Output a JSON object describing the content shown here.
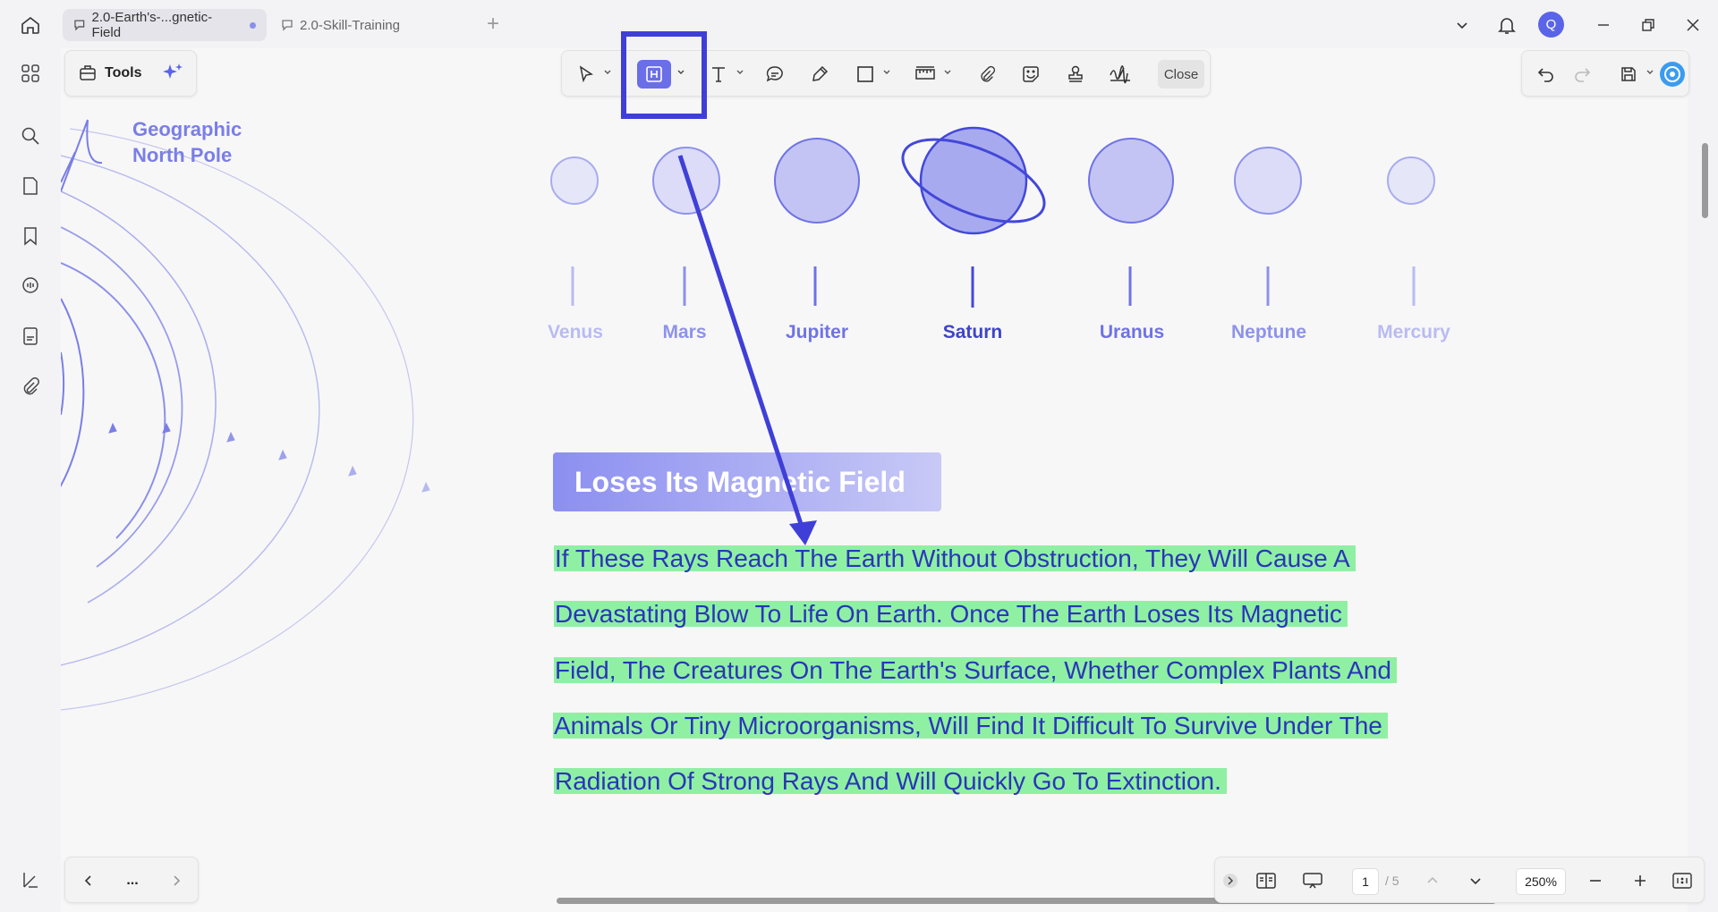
{
  "tabs": [
    {
      "label": "2.0-Earth's-...gnetic-Field",
      "active": true
    },
    {
      "label": "2.0-Skill-Training",
      "active": false
    }
  ],
  "user": {
    "initial": "Q"
  },
  "tools_panel": {
    "label": "Tools"
  },
  "toolbar": {
    "close_label": "Close"
  },
  "document": {
    "geo_label_line1": "Geographic",
    "geo_label_line2": "North Pole",
    "planets": [
      "Venus",
      "Mars",
      "Jupiter",
      "Saturn",
      "Uranus",
      "Neptune",
      "Mercury"
    ],
    "heading": "Loses Its Magnetic Field",
    "paragraph_lines": [
      "If These Rays Reach The Earth Without Obstruction, They Will Cause A",
      "Devastating Blow To Life On Earth. Once The Earth Loses Its Magnetic",
      "Field, The Creatures On The Earth's Surface, Whether Complex Plants And",
      "Animals Or Tiny Microorganisms, Will Find It Difficult To Survive Under The",
      "Radiation Of Strong Rays And Will Quickly Go To Extinction."
    ]
  },
  "nav": {
    "more_label": "..."
  },
  "view": {
    "page_current": "1",
    "page_total": "/ 5",
    "zoom": "250%"
  },
  "colors": {
    "accent": "#6a6ee8",
    "highlight_text": "#8ff0a4",
    "annotation": "#3f3fd8",
    "text_blue": "#2a35b8"
  }
}
